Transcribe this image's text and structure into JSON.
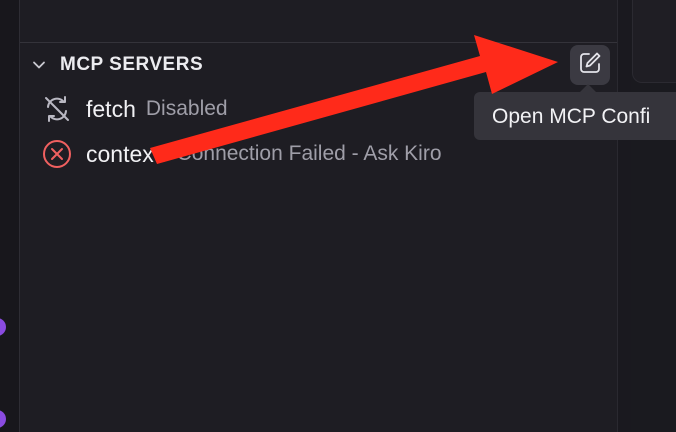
{
  "section": {
    "title": "MCP SERVERS"
  },
  "servers": [
    {
      "name": "fetch",
      "status": "Disabled",
      "icon": "sync-disabled-icon"
    },
    {
      "name": "contextI",
      "status": "Connection Failed - Ask Kiro",
      "icon": "error-circle-icon"
    }
  ],
  "header_action": {
    "icon": "edit-icon",
    "tooltip": "Open MCP Confi"
  },
  "annotation": {
    "arrow_color": "#ff2a1a"
  },
  "colors": {
    "background": "#1e1d23",
    "error": "#f06060",
    "muted_text": "#9f9ea8"
  }
}
